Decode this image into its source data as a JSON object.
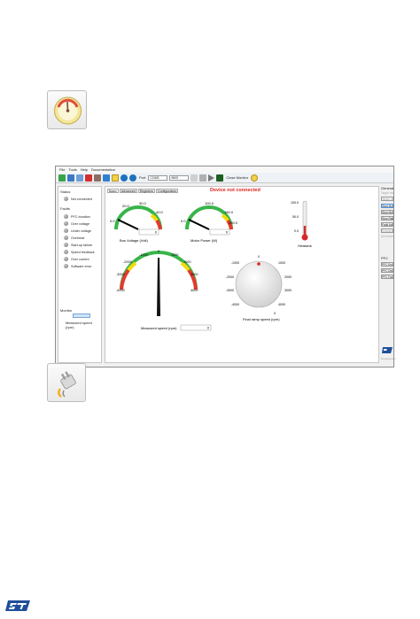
{
  "colors": {
    "accent": "#e0231c",
    "st_blue": "#1f4e9c",
    "gauge_green": "#39b54a",
    "gauge_yellow": "#f5d90a",
    "gauge_red": "#e33a2c"
  },
  "icons": {
    "monitor_gauge": "gauge-icon",
    "connect_plug": "plug-icon"
  },
  "app": {
    "menu": [
      "File",
      "Tools",
      "Help",
      "Documentation"
    ],
    "toolbar": {
      "port_label": "Port",
      "port_value": "COM3",
      "baud_value": "9600",
      "close_monitor_label": "Close Monitor"
    },
    "status_panel": {
      "status_label": "Status",
      "connection": "Not connected",
      "faults_label": "Faults",
      "faults": [
        "PFC duration",
        "Over voltage",
        "Under voltage",
        "Overheat",
        "Start-up failure",
        "Speed feedback",
        "Over current",
        "Software error"
      ],
      "monitor_label": "Monitor",
      "measured_speed_label": "Measured speed (rpm)"
    },
    "tabs": [
      "Basic",
      "Advanced",
      "Registers",
      "Configuration"
    ],
    "device_status": "Device not connected",
    "gauges": {
      "bus_voltage": {
        "label": "Bus Voltage (Volt)",
        "ticks": [
          "0.0",
          "20.0",
          "30.0",
          "40.0",
          "0"
        ],
        "value": 0
      },
      "motor_power": {
        "label": "Motor Power (W)",
        "ticks": [
          "0.0",
          "100.0",
          "150.0",
          "200.0",
          "0"
        ],
        "value": 0
      },
      "heatsink": {
        "label": "Heatsink",
        "ticks": [
          "100.0",
          "50.0",
          "0.0"
        ],
        "value": 0
      },
      "measured_speed": {
        "label": "Measured speed (rpm)",
        "ticks": [
          "-4000",
          "-3000",
          "-2000",
          "-1000",
          "0",
          "1000",
          "2000",
          "3000",
          "4000"
        ],
        "value": 0
      },
      "final_ramp": {
        "label": "Final ramp speed (rpm)",
        "ticks": [
          "0",
          "1000",
          "2000",
          "3000",
          "4000",
          "-4000",
          "-3000",
          "-2000",
          "-1000"
        ],
        "value": 0
      }
    },
    "right_panel": {
      "general_label": "General",
      "target_motor": "Target motor",
      "motor_select": "Motor 1",
      "buttons": [
        "Start Motor",
        "Stop Motor",
        "Stop Ramp",
        "Fault Ack",
        "Encoder Align"
      ],
      "all_motors_label": "All motors",
      "pfc_label": "PFC",
      "pfc_buttons": [
        "PFC Enable",
        "PFC Disable",
        "PFC Fault Ack."
      ],
      "logo_caption": "life.augmented"
    }
  },
  "footer": {
    "brand": "ST"
  }
}
